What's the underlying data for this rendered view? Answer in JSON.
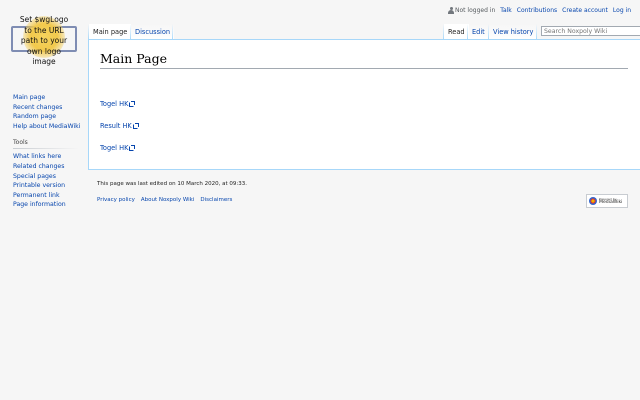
{
  "personal": {
    "not_logged_in": "Not logged in",
    "talk": "Talk",
    "contributions": "Contributions",
    "create_account": "Create account",
    "log_in": "Log in"
  },
  "logo": {
    "lines": [
      "Set $wgLogo",
      "to the URL",
      "path to your",
      "own logo",
      "image"
    ]
  },
  "navigation": {
    "items": [
      "Main page",
      "Recent changes",
      "Random page",
      "Help about MediaWiki"
    ]
  },
  "tools": {
    "heading": "Tools",
    "items": [
      "What links here",
      "Related changes",
      "Special pages",
      "Printable version",
      "Permanent link",
      "Page information"
    ]
  },
  "tabs": {
    "main_page": "Main page",
    "discussion": "Discussion",
    "read": "Read",
    "edit": "Edit",
    "view_history": "View history"
  },
  "search": {
    "placeholder": "Search Noxpoly Wiki"
  },
  "content": {
    "title": "Main Page",
    "links": [
      "Togel HK",
      "Result HK",
      "Togel HK"
    ]
  },
  "footer": {
    "lastmod": "This page was last edited on 10 March 2020, at 09:33.",
    "places": [
      "Privacy policy",
      "About Noxpoly Wiki",
      "Disclaimers"
    ],
    "powered_small": "Powered by",
    "powered_big": "MediaWiki"
  },
  "colors": {
    "link": "#0645ad",
    "tab_border": "#a7d7f9",
    "background": "#f6f6f6"
  }
}
